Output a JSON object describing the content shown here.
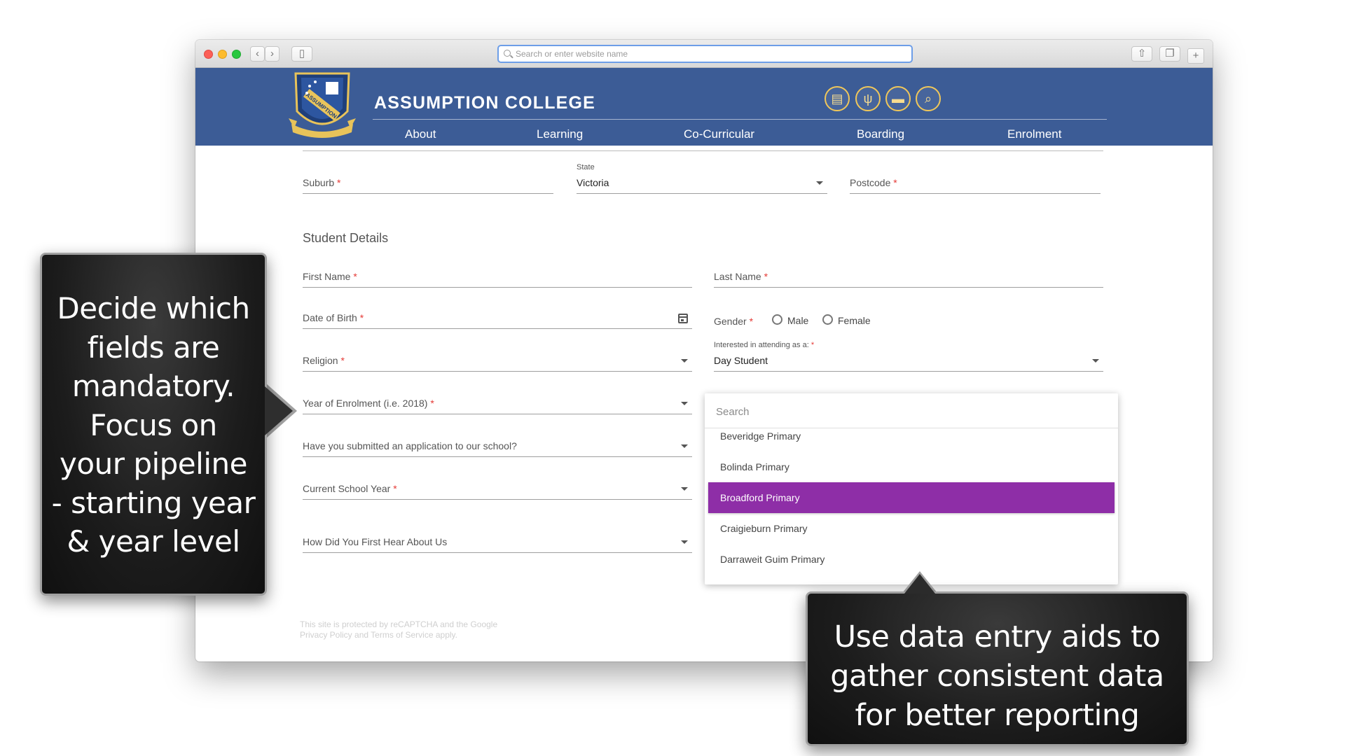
{
  "browser": {
    "url_placeholder": "Search or enter website name"
  },
  "site": {
    "name": "ASSUMPTION COLLEGE",
    "crest_motto": "ASSUMPTION",
    "nav": [
      "About",
      "Learning",
      "Co-Curricular",
      "Boarding",
      "Enrolment"
    ],
    "header_icons": [
      "document-icon",
      "cutlery-icon",
      "card-icon",
      "search-icon"
    ],
    "colors": {
      "header": "#3c5c96",
      "accent_gold": "#f0c75a",
      "selection": "#8e2ea7"
    }
  },
  "form": {
    "suburb_label": "Suburb",
    "state_label": "State",
    "state_value": "Victoria",
    "postcode_label": "Postcode",
    "student_heading": "Student Details",
    "first_name_label": "First Name",
    "last_name_label": "Last Name",
    "dob_label": "Date of Birth",
    "gender_label": "Gender",
    "gender_options": [
      "Male",
      "Female"
    ],
    "religion_label": "Religion",
    "attending_label": "Interested in attending as a:",
    "attending_value": "Day Student",
    "enrolment_year_label": "Year of Enrolment (i.e. 2018)",
    "submitted_label": "Have you submitted an application to our school?",
    "current_year_label": "Current School Year",
    "hear_label": "How Did You First Hear About Us",
    "required_mark": "*"
  },
  "dropdown": {
    "search_placeholder": "Search",
    "items": [
      "Beveridge Primary",
      "Bolinda Primary",
      "Broadford Primary",
      "Craigieburn Primary",
      "Darraweit Guim Primary"
    ],
    "selected_index": 2
  },
  "recaptcha": "This site is protected by reCAPTCHA and the Google Privacy Policy and Terms of Service apply.",
  "callouts": {
    "left": [
      "Decide which",
      "fields are",
      "mandatory.",
      "Focus on",
      "your pipeline",
      "- starting year",
      "& year level"
    ],
    "right": [
      "Use data entry aids to",
      "gather consistent data",
      "for better reporting"
    ]
  }
}
